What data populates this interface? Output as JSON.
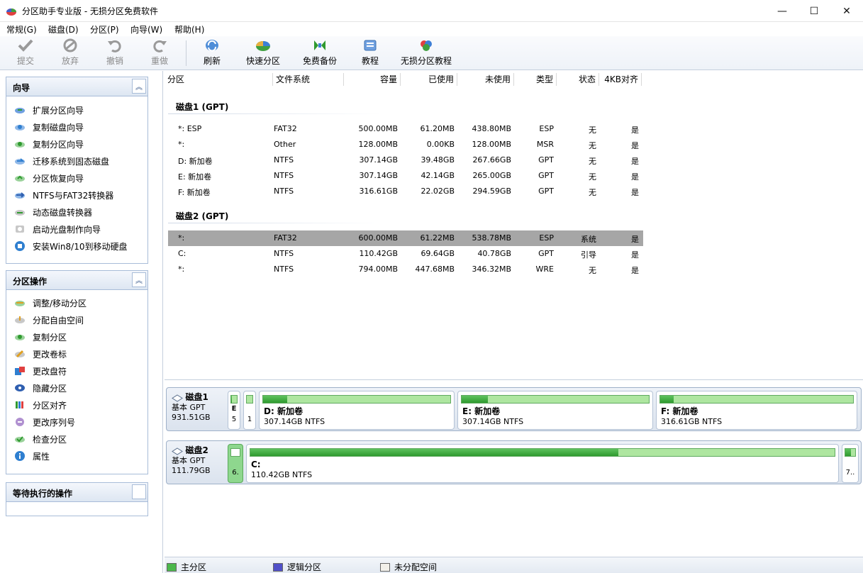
{
  "window": {
    "title": "分区助手专业版 - 无损分区免费软件",
    "minimize": "—",
    "maximize": "☐",
    "close": "✕"
  },
  "menu": [
    "常规(G)",
    "磁盘(D)",
    "分区(P)",
    "向导(W)",
    "帮助(H)"
  ],
  "toolbar": {
    "commit": "提交",
    "discard": "放弃",
    "undo": "撤销",
    "redo": "重做",
    "refresh": "刷新",
    "quick_partition": "快速分区",
    "free_backup": "免费备份",
    "tutorial": "教程",
    "lossless_tutorial": "无损分区教程"
  },
  "wizard_panel": {
    "title": "向导",
    "items": [
      "扩展分区向导",
      "复制磁盘向导",
      "复制分区向导",
      "迁移系统到固态磁盘",
      "分区恢复向导",
      "NTFS与FAT32转换器",
      "动态磁盘转换器",
      "启动光盘制作向导",
      "安装Win8/10到移动硬盘"
    ]
  },
  "ops_panel": {
    "title": "分区操作",
    "items": [
      "调整/移动分区",
      "分配自由空间",
      "复制分区",
      "更改卷标",
      "更改盘符",
      "隐藏分区",
      "分区对齐",
      "更改序列号",
      "检查分区",
      "属性"
    ]
  },
  "pending_panel": {
    "title": "等待执行的操作"
  },
  "columns": [
    "分区",
    "文件系统",
    "容量",
    "已使用",
    "未使用",
    "类型",
    "状态",
    "4KB对齐"
  ],
  "disks": [
    {
      "header": "磁盘1 (GPT)",
      "rows": [
        {
          "name": "*: ESP",
          "fs": "FAT32",
          "cap": "500.00MB",
          "used": "61.20MB",
          "free": "438.80MB",
          "type": "ESP",
          "status": "无",
          "align": "是"
        },
        {
          "name": "*:",
          "fs": "Other",
          "cap": "128.00MB",
          "used": "0.00KB",
          "free": "128.00MB",
          "type": "MSR",
          "status": "无",
          "align": "是"
        },
        {
          "name": "D: 新加卷",
          "fs": "NTFS",
          "cap": "307.14GB",
          "used": "39.48GB",
          "free": "267.66GB",
          "type": "GPT",
          "status": "无",
          "align": "是"
        },
        {
          "name": "E: 新加卷",
          "fs": "NTFS",
          "cap": "307.14GB",
          "used": "42.14GB",
          "free": "265.00GB",
          "type": "GPT",
          "status": "无",
          "align": "是"
        },
        {
          "name": "F: 新加卷",
          "fs": "NTFS",
          "cap": "316.61GB",
          "used": "22.02GB",
          "free": "294.59GB",
          "type": "GPT",
          "status": "无",
          "align": "是"
        }
      ]
    },
    {
      "header": "磁盘2 (GPT)",
      "rows": [
        {
          "name": "*:",
          "fs": "FAT32",
          "cap": "600.00MB",
          "used": "61.22MB",
          "free": "538.78MB",
          "type": "ESP",
          "status": "系统",
          "align": "是"
        },
        {
          "name": "C:",
          "fs": "NTFS",
          "cap": "110.42GB",
          "used": "69.64GB",
          "free": "40.78GB",
          "type": "GPT",
          "status": "引导",
          "align": "是"
        },
        {
          "name": "*:",
          "fs": "NTFS",
          "cap": "794.00MB",
          "used": "447.68MB",
          "free": "346.32MB",
          "type": "WRE",
          "status": "无",
          "align": "是"
        }
      ]
    }
  ],
  "map": {
    "disk1": {
      "name": "磁盘1",
      "style": "基本 GPT",
      "size": "931.51GB",
      "small1": "E",
      "small1b": "5",
      "small2": "1",
      "d": {
        "name": "D: 新加卷",
        "info": "307.14GB NTFS",
        "used_fraction": 0.13
      },
      "e": {
        "name": "E: 新加卷",
        "info": "307.14GB NTFS",
        "used_fraction": 0.14
      },
      "f": {
        "name": "F: 新加卷",
        "info": "316.61GB NTFS",
        "used_fraction": 0.07
      }
    },
    "disk2": {
      "name": "磁盘2",
      "style": "基本 GPT",
      "size": "111.79GB",
      "small1": "6.",
      "c": {
        "name": "C:",
        "info": "110.42GB NTFS",
        "used_fraction": 0.63
      },
      "small_end": "7.."
    }
  },
  "legend": [
    "主分区",
    "逻辑分区",
    "未分配空间"
  ],
  "colors": {
    "primary": "#4cb84c",
    "logical": "#5050c8",
    "unallocated": "#f2f0ea",
    "selected_row": "#a6a6a6"
  }
}
